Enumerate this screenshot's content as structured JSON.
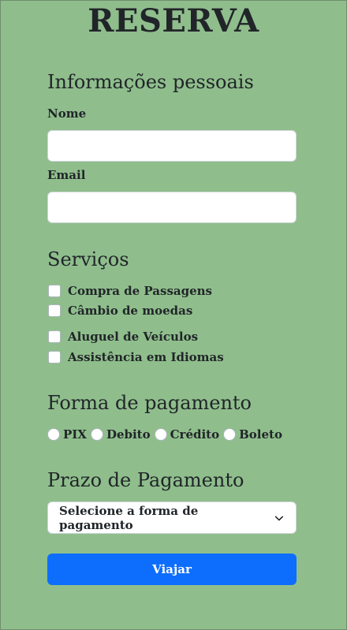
{
  "page": {
    "title": "RESERVA"
  },
  "personal": {
    "heading": "Informações pessoais",
    "name_label": "Nome",
    "name_value": "",
    "email_label": "Email",
    "email_value": ""
  },
  "services": {
    "heading": "Serviços",
    "items": [
      {
        "label": "Compra de Passagens",
        "checked": false
      },
      {
        "label": "Câmbio de moedas",
        "checked": false
      },
      {
        "label": "Aluguel de Veículos",
        "checked": false
      },
      {
        "label": "Assistência em Idiomas",
        "checked": false
      }
    ]
  },
  "payment": {
    "heading": "Forma de pagamento",
    "options": [
      {
        "label": "PIX",
        "selected": false
      },
      {
        "label": "Debito",
        "selected": false
      },
      {
        "label": "Crédito",
        "selected": false
      },
      {
        "label": "Boleto",
        "selected": false
      }
    ]
  },
  "term": {
    "heading": "Prazo de Pagamento",
    "select_value": "Selecione a forma de pagamento"
  },
  "submit": {
    "label": "Viajar"
  },
  "colors": {
    "background": "#8fbe8c",
    "button": "#0d6efd",
    "text": "#212529"
  }
}
